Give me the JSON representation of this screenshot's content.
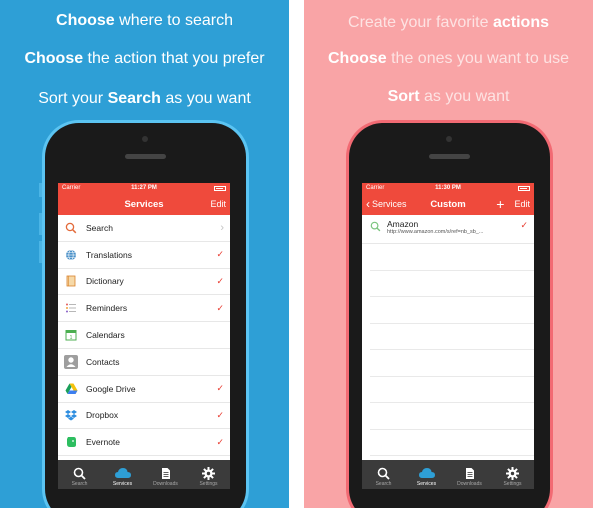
{
  "left": {
    "headlines": [
      {
        "bold": "Choose",
        "rest": " where to search"
      },
      {
        "bold": "Choose",
        "rest": " the action that you prefer"
      },
      {
        "pre": "Sort your ",
        "bold": "Search",
        "rest": " as you want"
      }
    ],
    "status": {
      "carrier": "Carrier",
      "time": "11:27 PM"
    },
    "nav": {
      "title": "Services",
      "edit": "Edit"
    },
    "rows": [
      {
        "label": "Search",
        "icon": "search-icon",
        "accessory": ">"
      },
      {
        "label": "Translations",
        "icon": "globe-icon",
        "accessory": "✓"
      },
      {
        "label": "Dictionary",
        "icon": "dictionary-icon",
        "accessory": "✓"
      },
      {
        "label": "Reminders",
        "icon": "reminders-icon",
        "accessory": "✓"
      },
      {
        "label": "Calendars",
        "icon": "calendar-icon",
        "accessory": ""
      },
      {
        "label": "Contacts",
        "icon": "contacts-icon",
        "accessory": ""
      },
      {
        "label": "Google Drive",
        "icon": "google-drive-icon",
        "accessory": "✓"
      },
      {
        "label": "Dropbox",
        "icon": "dropbox-icon",
        "accessory": "✓"
      },
      {
        "label": "Evernote",
        "icon": "evernote-icon",
        "accessory": "✓"
      }
    ],
    "tabs": [
      {
        "label": "Search",
        "icon": "search-icon",
        "active": false
      },
      {
        "label": "Services",
        "icon": "cloud-icon",
        "active": true
      },
      {
        "label": "Downloads",
        "icon": "document-icon",
        "active": false
      },
      {
        "label": "Settings",
        "icon": "gear-icon",
        "active": false
      }
    ],
    "colors": {
      "background": "#2e9fd6",
      "accent": "#ef4a3c"
    }
  },
  "right": {
    "headlines": [
      {
        "pre": "Create your favorite ",
        "bold": "actions",
        "rest": ""
      },
      {
        "bold": "Choose",
        "rest": " the ones you want to use"
      },
      {
        "bold": "Sort",
        "rest": " as you want"
      }
    ],
    "status": {
      "carrier": "Carrier",
      "time": "11:30 PM"
    },
    "nav": {
      "back": "Services",
      "title": "Custom",
      "plus": "+",
      "edit": "Edit"
    },
    "custom": {
      "name": "Amazon",
      "url": "http://www.amazon.com/s/ref=nb_sb_...",
      "accessory": "✓"
    },
    "tabs": [
      {
        "label": "Search",
        "icon": "search-icon",
        "active": false
      },
      {
        "label": "Services",
        "icon": "cloud-icon",
        "active": true
      },
      {
        "label": "Downloads",
        "icon": "document-icon",
        "active": false
      },
      {
        "label": "Settings",
        "icon": "gear-icon",
        "active": false
      }
    ],
    "colors": {
      "background": "#f9a4a6",
      "accent": "#ef4a3c"
    }
  }
}
